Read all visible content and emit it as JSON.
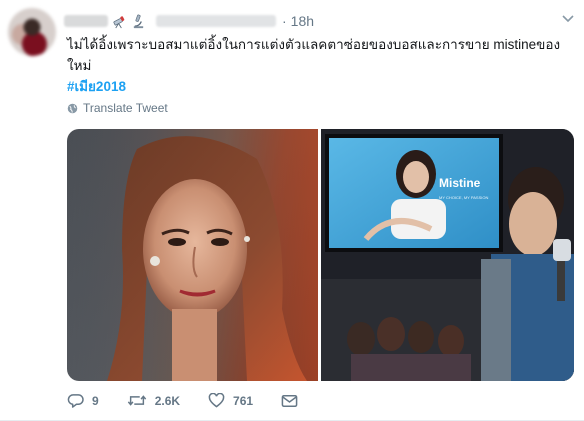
{
  "tweet": {
    "timestamp": "18h",
    "text": "ไม่ได้อิ้งเพราะบอสมาแต่อิ้งในการแต่งตัวแลคตาซ่อยของบอสและการขาย mistineของใหม่",
    "hashtag": "#เมีย2018",
    "translate_label": "Translate Tweet",
    "billboard_brand": "Mistine",
    "billboard_tagline": "MY CHOICE, MY PASSION"
  },
  "actions": {
    "reply_count": "9",
    "retweet_count": "2.6K",
    "like_count": "761"
  },
  "colors": {
    "link": "#1da1f2",
    "secondary": "#657786",
    "text": "#14171a"
  },
  "icons": [
    "telescope-icon",
    "microscope-icon",
    "caret-down-icon",
    "globe-icon",
    "reply-icon",
    "retweet-icon",
    "like-icon",
    "message-icon"
  ]
}
